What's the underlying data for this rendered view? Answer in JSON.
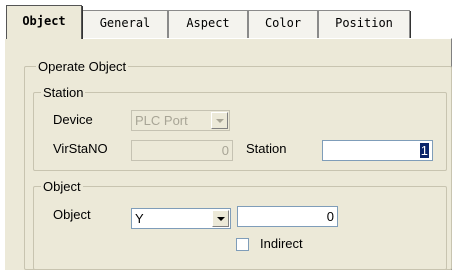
{
  "tabs": [
    {
      "label": "Object"
    },
    {
      "label": "General"
    },
    {
      "label": "Aspect"
    },
    {
      "label": "Color"
    },
    {
      "label": "Position"
    }
  ],
  "operate_object": {
    "title": "Operate Object",
    "station": {
      "title": "Station",
      "device_label": "Device",
      "device_value": "PLC Port",
      "virstano_label": "VirStaNO",
      "virstano_value": "0",
      "station_label": "Station",
      "station_value": "1"
    },
    "object": {
      "title": "Object",
      "object_label": "Object",
      "object_type": "Y",
      "object_address": "0",
      "indirect_label": "Indirect",
      "indirect_checked": false
    }
  }
}
